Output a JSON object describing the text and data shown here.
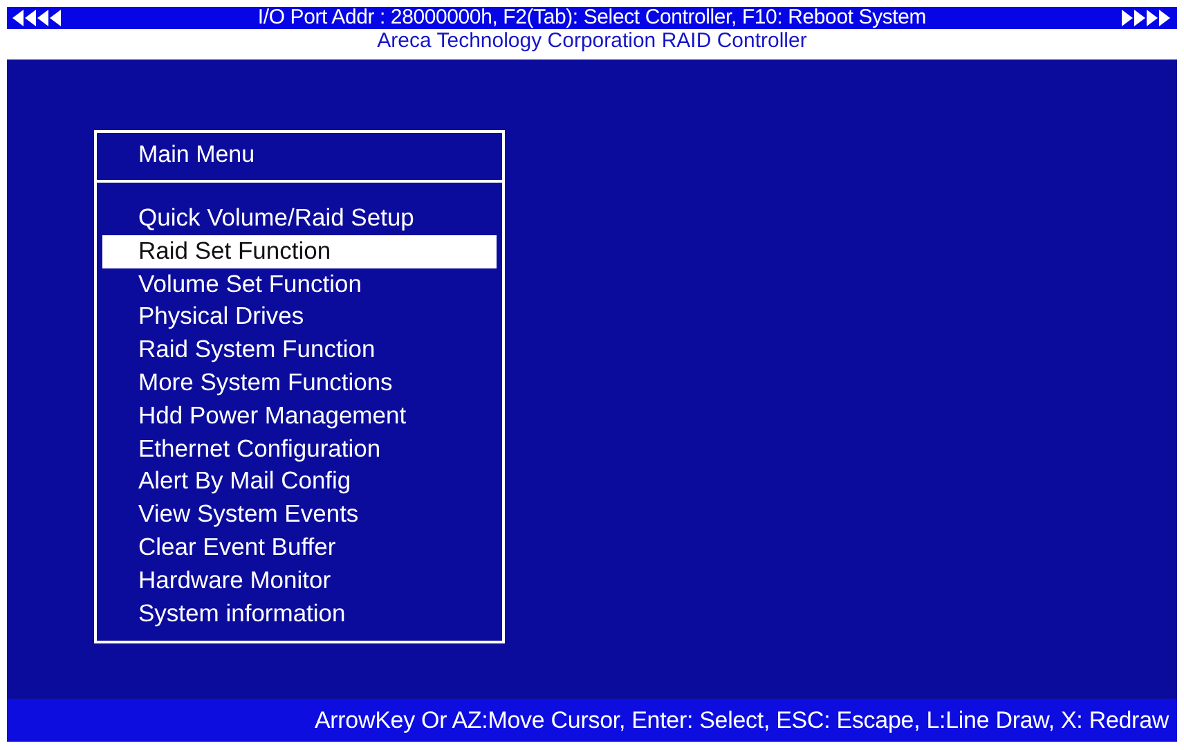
{
  "top_bar": {
    "text": "I/O Port Addr : 28000000h, F2(Tab): Select Controller, F10: Reboot System"
  },
  "subtitle": "Areca Technology Corporation RAID Controller",
  "menu": {
    "title": "Main Menu",
    "items": [
      {
        "label": "Quick Volume/Raid Setup",
        "selected": false
      },
      {
        "label": "Raid Set Function",
        "selected": true
      },
      {
        "label": "Volume Set Function",
        "selected": false
      },
      {
        "label": "Physical Drives",
        "selected": false
      },
      {
        "label": "Raid System Function",
        "selected": false
      },
      {
        "label": "More System Functions",
        "selected": false
      },
      {
        "label": "Hdd Power Management",
        "selected": false
      },
      {
        "label": "Ethernet Configuration",
        "selected": false
      },
      {
        "label": "Alert By Mail Config",
        "selected": false
      },
      {
        "label": "View System Events",
        "selected": false
      },
      {
        "label": "Clear Event Buffer",
        "selected": false
      },
      {
        "label": "Hardware Monitor",
        "selected": false
      },
      {
        "label": "System information",
        "selected": false
      }
    ]
  },
  "status_bar": "ArrowKey Or AZ:Move Cursor, Enter: Select, ESC: Escape, L:Line Draw, X: Redraw"
}
